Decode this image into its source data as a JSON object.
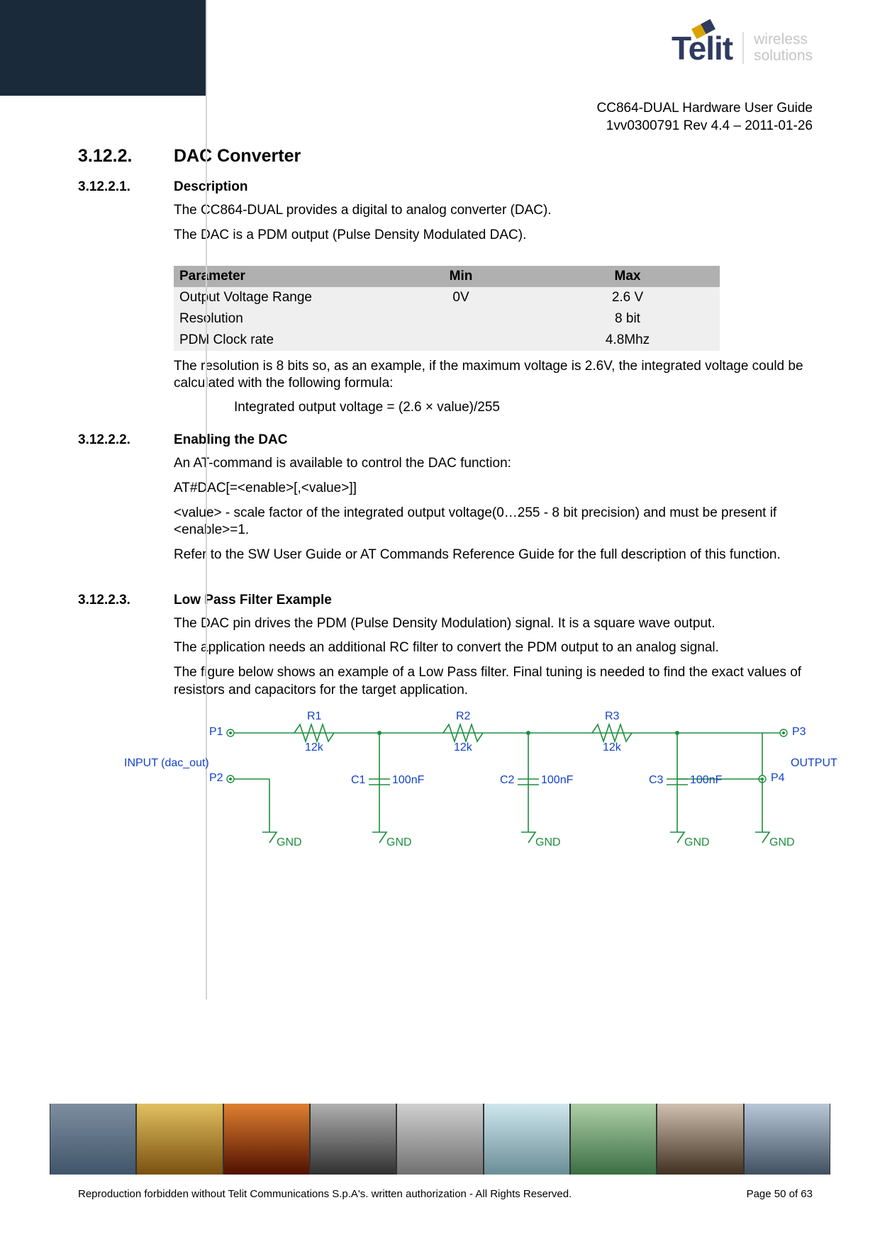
{
  "header": {
    "brand_name": "Telit",
    "brand_tag_line1": "wireless",
    "brand_tag_line2": "solutions",
    "doc_title": "CC864-DUAL Hardware User Guide",
    "doc_rev": "1vv0300791 Rev 4.4 – 2011-01-26"
  },
  "sections": {
    "s1_num": "3.12.2.",
    "s1_title": "DAC Converter",
    "s11_num": "3.12.2.1.",
    "s11_title": "Description",
    "s11_p1": "The CC864-DUAL provides a digital to analog converter (DAC).",
    "s11_p2": "The DAC is a PDM output (Pulse Density Modulated DAC).",
    "table": {
      "h1": "Parameter",
      "h2": "Min",
      "h3": "Max",
      "rows": [
        {
          "p": "Output Voltage Range",
          "min": "0V",
          "max": "2.6 V"
        },
        {
          "p": "Resolution",
          "min": "",
          "max": "8 bit"
        },
        {
          "p": "PDM Clock rate",
          "min": "",
          "max": "4.8Mhz"
        }
      ]
    },
    "s11_p3": "The resolution is 8 bits so, as an example, if the maximum voltage is 2.6V, the integrated voltage could be calculated with the following formula:",
    "s11_formula": "Integrated output voltage = (2.6 × value)/255",
    "s12_num": "3.12.2.2.",
    "s12_title": "Enabling the DAC",
    "s12_p1": "An AT-command is available to control the DAC function:",
    "s12_p2": "AT#DAC[=<enable>[,<value>]]",
    "s12_p3": "<value> - scale factor of the integrated output voltage(0…255 - 8 bit precision) and must be present if <enable>=1.",
    "s12_p4": "Refer to the SW User Guide or AT Commands Reference Guide for the full description of this function.",
    "s13_num": "3.12.2.3.",
    "s13_title": "Low Pass Filter Example",
    "s13_p1": "The DAC pin drives the PDM (Pulse Density Modulation) signal. It is a square wave output.",
    "s13_p2": "The application needs an additional RC filter to convert the PDM output to an analog signal.",
    "s13_p3": "The figure below shows an example of a Low Pass filter. Final tuning is needed to find the exact values of resistors and capacitors for the target application."
  },
  "circuit": {
    "input_label": "INPUT (dac_out)",
    "output_label": "OUTPUT",
    "P1": "P1",
    "P2": "P2",
    "P3": "P3",
    "P4": "P4",
    "R1": "R1",
    "R2": "R2",
    "R3": "R3",
    "Rval": "12k",
    "C1": "C1",
    "C2": "C2",
    "C3": "C3",
    "Cval": "100nF",
    "GND": "GND"
  },
  "footer": {
    "copyright": "Reproduction forbidden without Telit Communications S.p.A's. written authorization - All Rights Reserved.",
    "page": "Page 50 of 63"
  }
}
